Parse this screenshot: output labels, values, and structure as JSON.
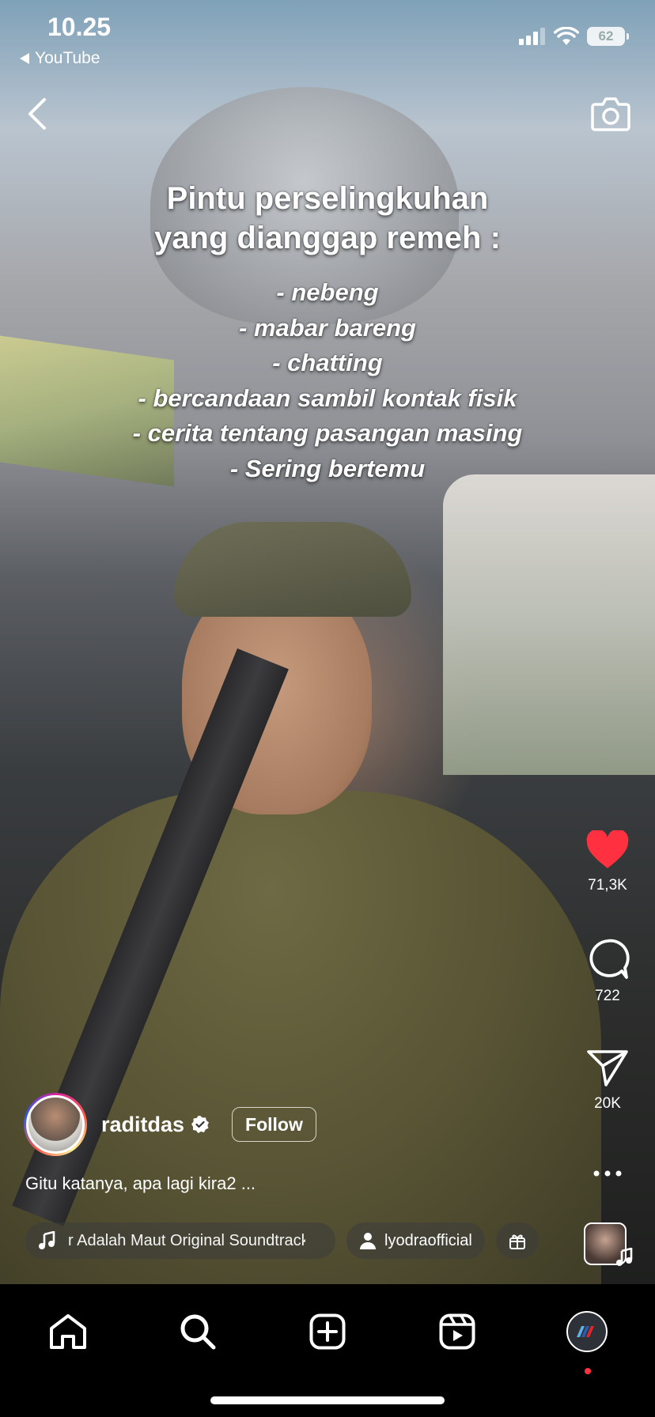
{
  "status_bar": {
    "time": "10.25",
    "back_app": "YouTube",
    "battery": "62"
  },
  "icons": {
    "back": "chevron-left-icon",
    "camera": "camera-icon",
    "like": "heart-icon",
    "comment": "comment-icon",
    "share": "send-icon",
    "more": "more-icon"
  },
  "overlay": {
    "title_lines": [
      "Pintu perselingkuhan",
      "yang dianggap remeh :"
    ],
    "list_lines": [
      "- nebeng",
      "- mabar bareng",
      "- chatting",
      "- bercandaan sambil kontak fisik",
      "- cerita tentang pasangan masing",
      "- Sering bertemu"
    ]
  },
  "actions": {
    "likes": "71,3K",
    "comments": "722",
    "shares": "20K"
  },
  "author": {
    "username": "raditdas",
    "follow_label": "Follow"
  },
  "caption": "Gitu katanya, apa lagi kira2 ...",
  "chips": {
    "music": "r Adalah Maut Original Soundtrack",
    "user": "lyodraofficial"
  },
  "colors": {
    "like": "#ff3040",
    "nav_bg": "#000000"
  }
}
